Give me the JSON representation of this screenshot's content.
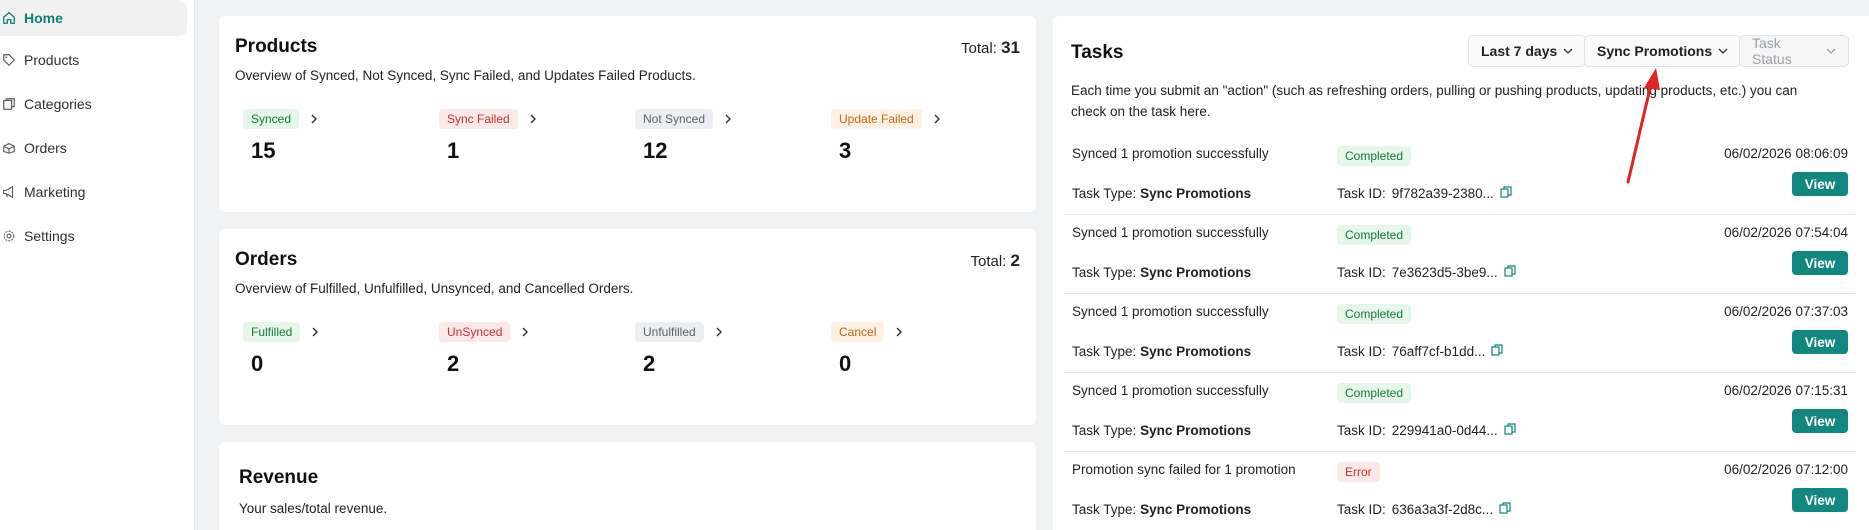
{
  "sidebar": {
    "items": [
      {
        "label": "Home",
        "icon": "home-icon",
        "active": true
      },
      {
        "label": "Products",
        "icon": "tag-icon",
        "active": false
      },
      {
        "label": "Categories",
        "icon": "categories-icon",
        "active": false
      },
      {
        "label": "Orders",
        "icon": "orders-icon",
        "active": false
      },
      {
        "label": "Marketing",
        "icon": "megaphone-icon",
        "active": false
      },
      {
        "label": "Settings",
        "icon": "gear-icon",
        "active": false
      }
    ]
  },
  "products": {
    "title": "Products",
    "total_label": "Total:",
    "total_value": "31",
    "description": "Overview of Synced, Not Synced, Sync Failed, and Updates Failed Products.",
    "stats": [
      {
        "label": "Synced",
        "value": "15",
        "tone": "green"
      },
      {
        "label": "Sync Failed",
        "value": "1",
        "tone": "red"
      },
      {
        "label": "Not Synced",
        "value": "12",
        "tone": "gray"
      },
      {
        "label": "Update Failed",
        "value": "3",
        "tone": "orange"
      }
    ]
  },
  "orders": {
    "title": "Orders",
    "total_label": "Total:",
    "total_value": "2",
    "description": "Overview of Fulfilled, Unfulfilled, Unsynced, and Cancelled Orders.",
    "stats": [
      {
        "label": "Fulfilled",
        "value": "0",
        "tone": "green"
      },
      {
        "label": "UnSynced",
        "value": "2",
        "tone": "red"
      },
      {
        "label": "Unfulfilled",
        "value": "2",
        "tone": "gray"
      },
      {
        "label": "Cancel",
        "value": "0",
        "tone": "orange"
      }
    ]
  },
  "revenue": {
    "title": "Revenue",
    "description": "Your sales/total revenue."
  },
  "tasks": {
    "title": "Tasks",
    "filters": {
      "period": "Last 7 days",
      "type": "Sync Promotions",
      "status": "Task Status"
    },
    "description_line1": "Each time you submit an \"action\" (such as refreshing orders, pulling or pushing products, updating products, etc.) you can",
    "description_line2": "check on the task here.",
    "type_label": "Task Type:",
    "id_label": "Task ID:",
    "view_label": "View",
    "rows": [
      {
        "message": "Synced 1 promotion successfully",
        "status": "Completed",
        "tone": "green",
        "type": "Sync Promotions",
        "id": "9f782a39-2380...",
        "time": "06/02/2026 08:06:09"
      },
      {
        "message": "Synced 1 promotion successfully",
        "status": "Completed",
        "tone": "green",
        "type": "Sync Promotions",
        "id": "7e3623d5-3be9...",
        "time": "06/02/2026 07:54:04"
      },
      {
        "message": "Synced 1 promotion successfully",
        "status": "Completed",
        "tone": "green",
        "type": "Sync Promotions",
        "id": "76aff7cf-b1dd...",
        "time": "06/02/2026 07:37:03"
      },
      {
        "message": "Synced 1 promotion successfully",
        "status": "Completed",
        "tone": "green",
        "type": "Sync Promotions",
        "id": "229941a0-0d44...",
        "time": "06/02/2026 07:15:31"
      },
      {
        "message": "Promotion sync failed for 1 promotion",
        "status": "Error",
        "tone": "red",
        "type": "Sync Promotions",
        "id": "636a3a3f-2d8c...",
        "time": "06/02/2026 07:12:00"
      }
    ]
  },
  "colors": {
    "accent": "#0b7f78",
    "view_button": "#12877f",
    "annotation_arrow": "#e02424"
  }
}
